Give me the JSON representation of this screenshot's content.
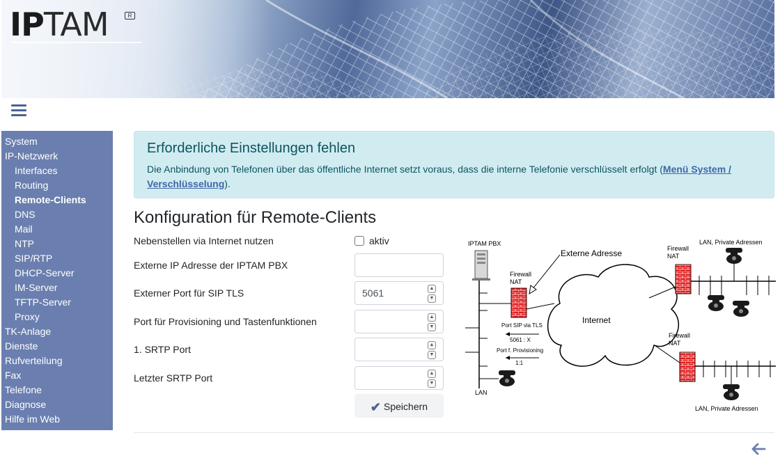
{
  "logo": {
    "bold": "IP",
    "light": "TAM",
    "reg_mark": "R"
  },
  "sidebar": {
    "items": [
      {
        "label": "System",
        "sub": false,
        "active": false
      },
      {
        "label": "IP-Netzwerk",
        "sub": false,
        "active": false
      },
      {
        "label": "Interfaces",
        "sub": true,
        "active": false
      },
      {
        "label": "Routing",
        "sub": true,
        "active": false
      },
      {
        "label": "Remote-Clients",
        "sub": true,
        "active": true
      },
      {
        "label": "DNS",
        "sub": true,
        "active": false
      },
      {
        "label": "Mail",
        "sub": true,
        "active": false
      },
      {
        "label": "NTP",
        "sub": true,
        "active": false
      },
      {
        "label": "SIP/RTP",
        "sub": true,
        "active": false
      },
      {
        "label": "DHCP-Server",
        "sub": true,
        "active": false
      },
      {
        "label": "IM-Server",
        "sub": true,
        "active": false
      },
      {
        "label": "TFTP-Server",
        "sub": true,
        "active": false
      },
      {
        "label": "Proxy",
        "sub": true,
        "active": false
      },
      {
        "label": "TK-Anlage",
        "sub": false,
        "active": false
      },
      {
        "label": "Dienste",
        "sub": false,
        "active": false
      },
      {
        "label": "Rufverteilung",
        "sub": false,
        "active": false
      },
      {
        "label": "Fax",
        "sub": false,
        "active": false
      },
      {
        "label": "Telefone",
        "sub": false,
        "active": false
      },
      {
        "label": "Diagnose",
        "sub": false,
        "active": false
      },
      {
        "label": "Hilfe im Web",
        "sub": false,
        "active": false
      }
    ]
  },
  "alert": {
    "title": "Erforderliche Einstellungen fehlen",
    "text_before": "Die Anbindung von Telefonen über das öffentliche Internet setzt voraus, dass die interne Telefonie verschlüsselt erfolgt (",
    "link": "Menü System / Verschlüsselung",
    "text_after": ")."
  },
  "form": {
    "title": "Konfiguration für Remote-Clients",
    "internet_label": "Nebenstellen via Internet nutzen",
    "aktiv_label": "aktiv",
    "aktiv_checked": false,
    "ext_ip_label": "Externe IP Adresse der IPTAM PBX",
    "ext_ip_value": "",
    "sip_tls_label": "Externer Port für SIP TLS",
    "sip_tls_value": "5061",
    "prov_label": "Port für Provisioning und Tastenfunktionen",
    "prov_value": "",
    "srtp1_label": "1. SRTP Port",
    "srtp1_value": "",
    "srtp_last_label": "Letzter SRTP Port",
    "srtp_last_value": "",
    "save_label": "Speichern"
  },
  "diagram": {
    "pbx_label": "IPTAM PBX",
    "firewall_label": "Firewall",
    "nat_label": "NAT",
    "external_address": "Externe Adresse",
    "internet": "Internet",
    "port_sip": "Port SIP via TLS",
    "port_sip_map": "5061 : X",
    "port_prov": "Port f. Provisioning",
    "port_prov_map": "1:1",
    "lan": "LAN",
    "lan_private": "LAN, Private Adressen"
  },
  "colors": {
    "sidebar": "#6a7faf",
    "alert_bg": "#d1ecf1",
    "alert_text": "#0c5460",
    "accent": "#4a6393",
    "firewall": "#e02020"
  }
}
